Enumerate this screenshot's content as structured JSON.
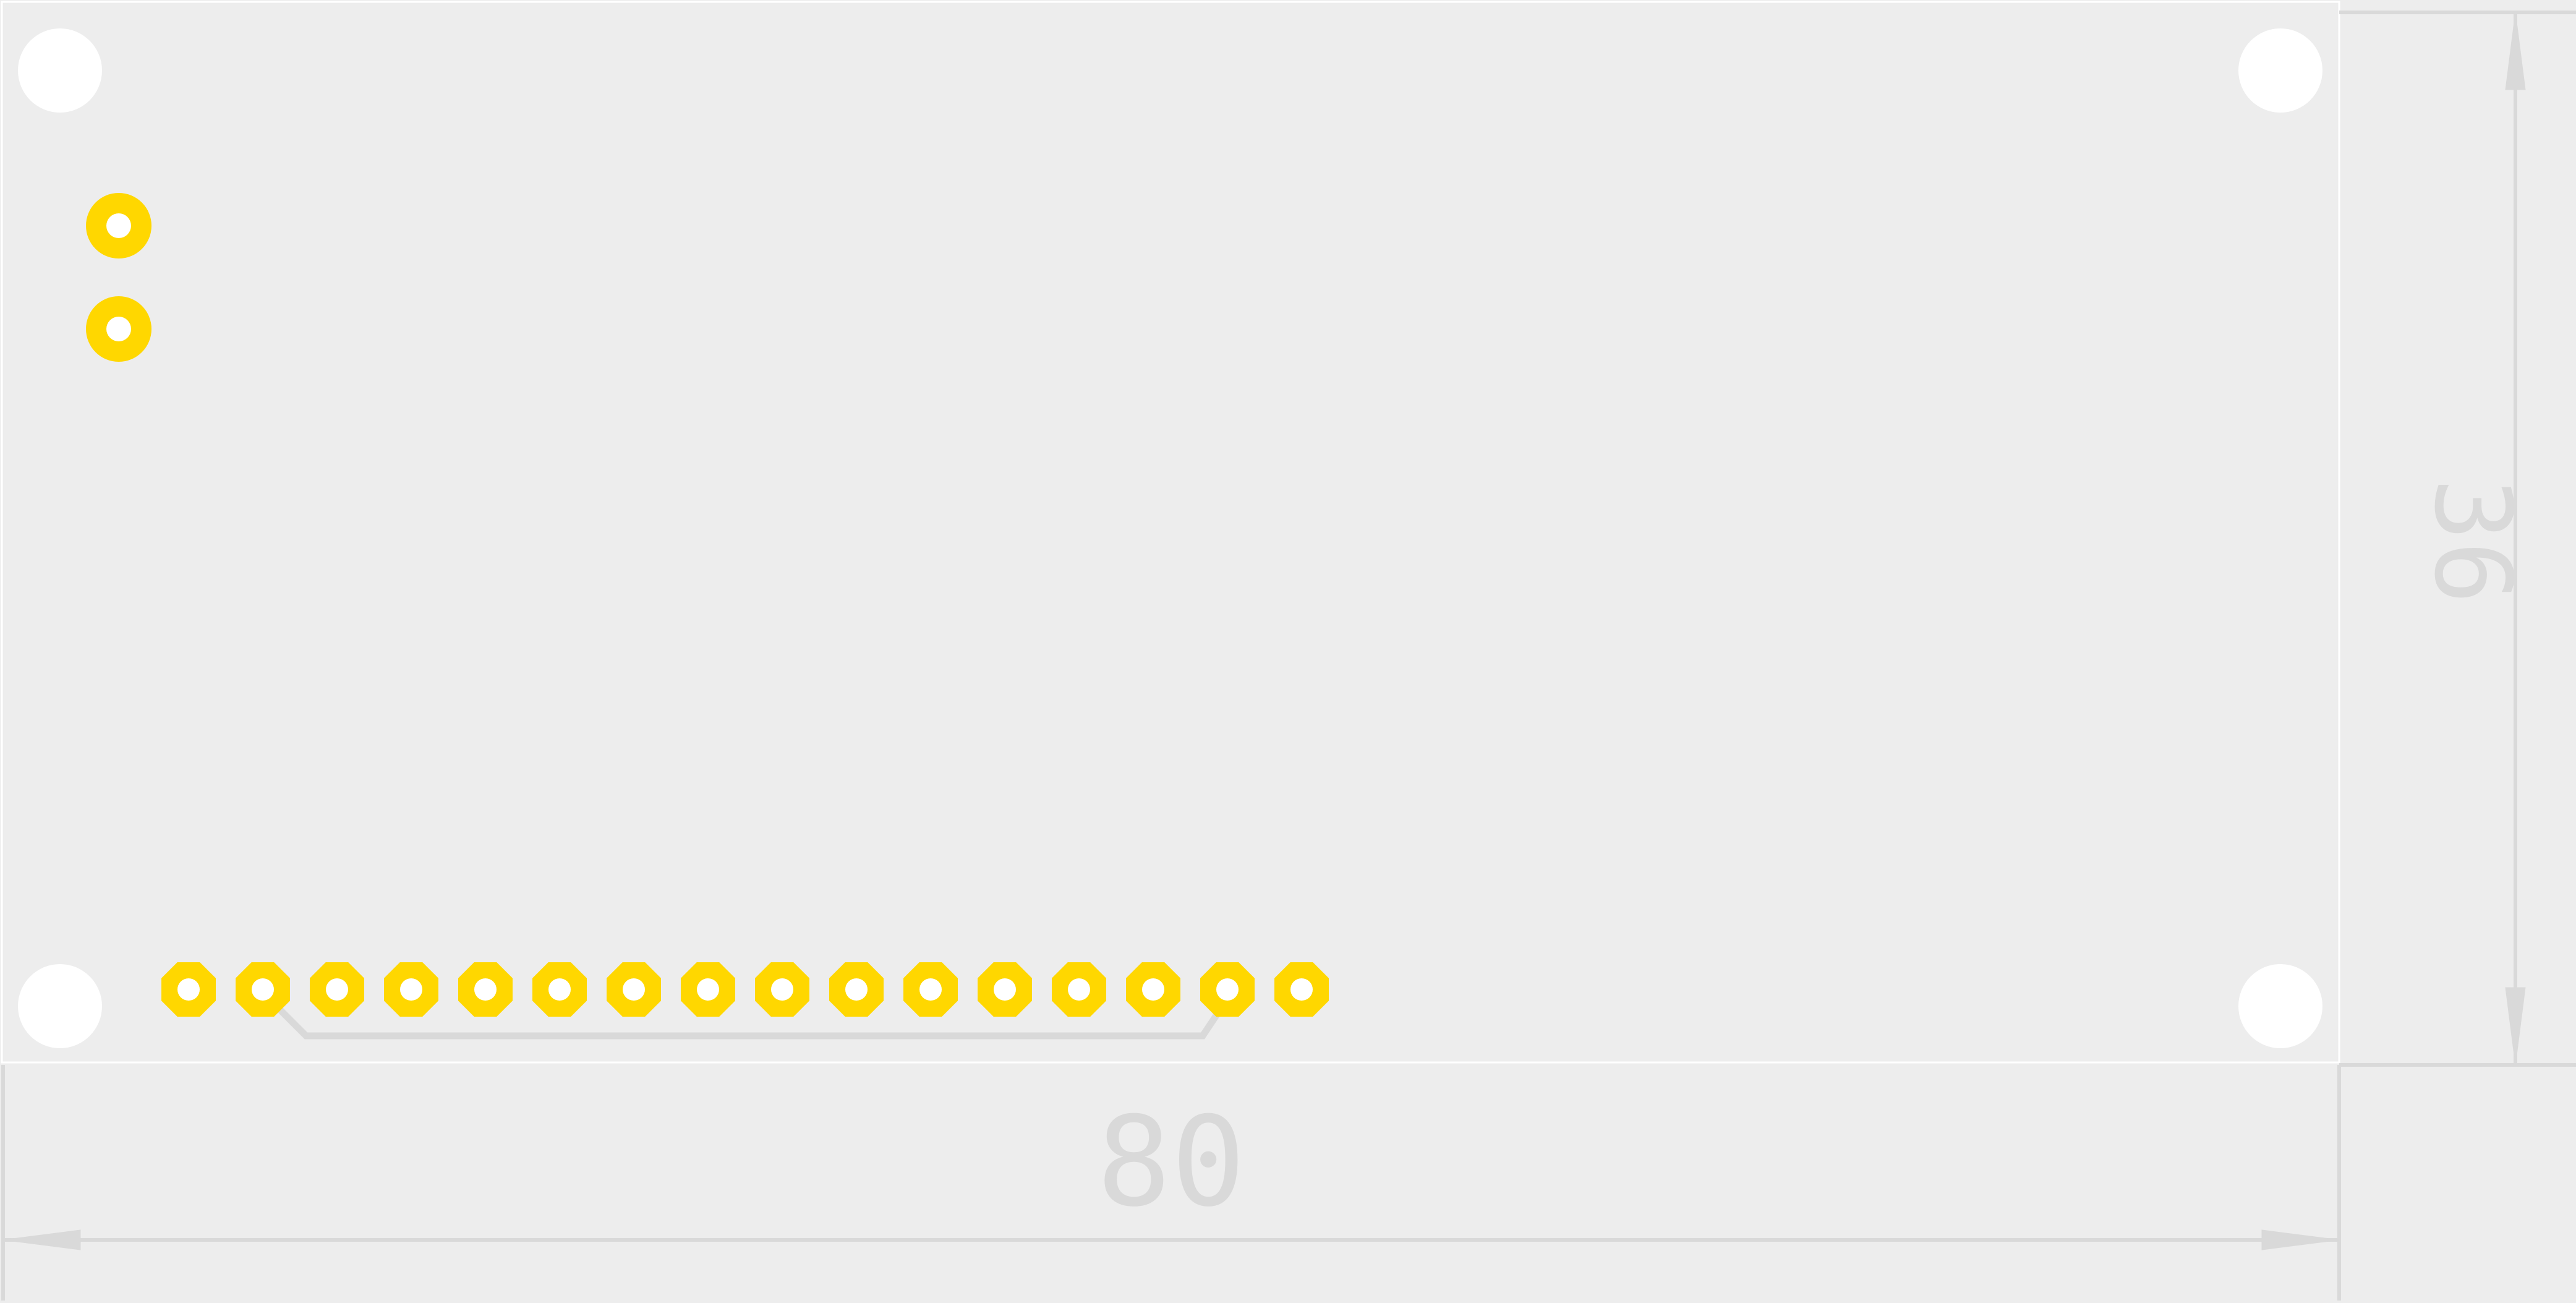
{
  "board": {
    "outline_color": "#ffffff",
    "background_color": "#ededed",
    "pad_color": "#ffd700",
    "silk_color": "#d9d9d9"
  },
  "pads": {
    "round_count": 2,
    "header_pin_count": 16
  },
  "dimensions": {
    "width_label": "80",
    "height_label": "36"
  },
  "icons": {
    "mounting_hole": "mounting-hole-icon",
    "pad": "pad-icon",
    "arrow": "arrowhead-icon"
  }
}
